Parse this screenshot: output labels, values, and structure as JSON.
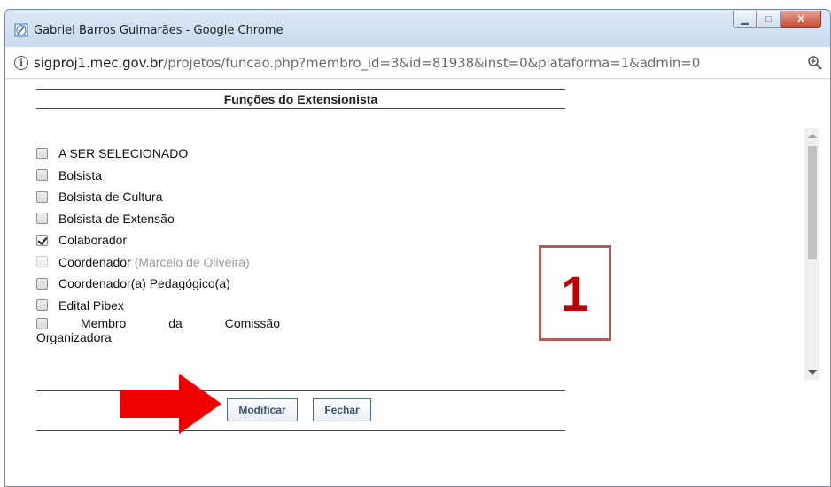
{
  "window": {
    "title": "Gabriel Barros Guimarães - Google Chrome",
    "controls": {
      "minimize": "▁",
      "maximize": "□",
      "close": "X"
    }
  },
  "address": {
    "host": "sigproj1.mec.gov.br",
    "path": "/projetos/funcao.php?membro_id=3&id=81938&inst=0&plataforma=1&admin=0",
    "info_icon": "info-icon",
    "zoom_icon": "zoom-icon"
  },
  "panel": {
    "title": "Funções do Extensionista",
    "items": [
      {
        "label": "A SER SELECIONADO",
        "checked": false,
        "disabled": false
      },
      {
        "label": "Bolsista",
        "checked": false,
        "disabled": false
      },
      {
        "label": "Bolsista de Cultura",
        "checked": false,
        "disabled": false
      },
      {
        "label": "Bolsista de Extensão",
        "checked": false,
        "disabled": false
      },
      {
        "label": "Colaborador",
        "checked": true,
        "disabled": false
      },
      {
        "label": "Coordenador",
        "note": "(Marcelo de Oliveira)",
        "checked": false,
        "disabled": true
      },
      {
        "label": "Coordenador(a) Pedagógico(a)",
        "checked": false,
        "disabled": false
      },
      {
        "label": "Edital Pibex",
        "checked": false,
        "disabled": false
      },
      {
        "label_words": [
          "Membro",
          "da",
          "Comissão"
        ],
        "label_cont": "Organizadora",
        "checked": false,
        "disabled": false
      }
    ],
    "buttons": {
      "modify": "Modificar",
      "close": "Fechar"
    }
  },
  "annotation": {
    "number": "1",
    "color": "#c00000",
    "arrow_color": "#ee0000"
  }
}
